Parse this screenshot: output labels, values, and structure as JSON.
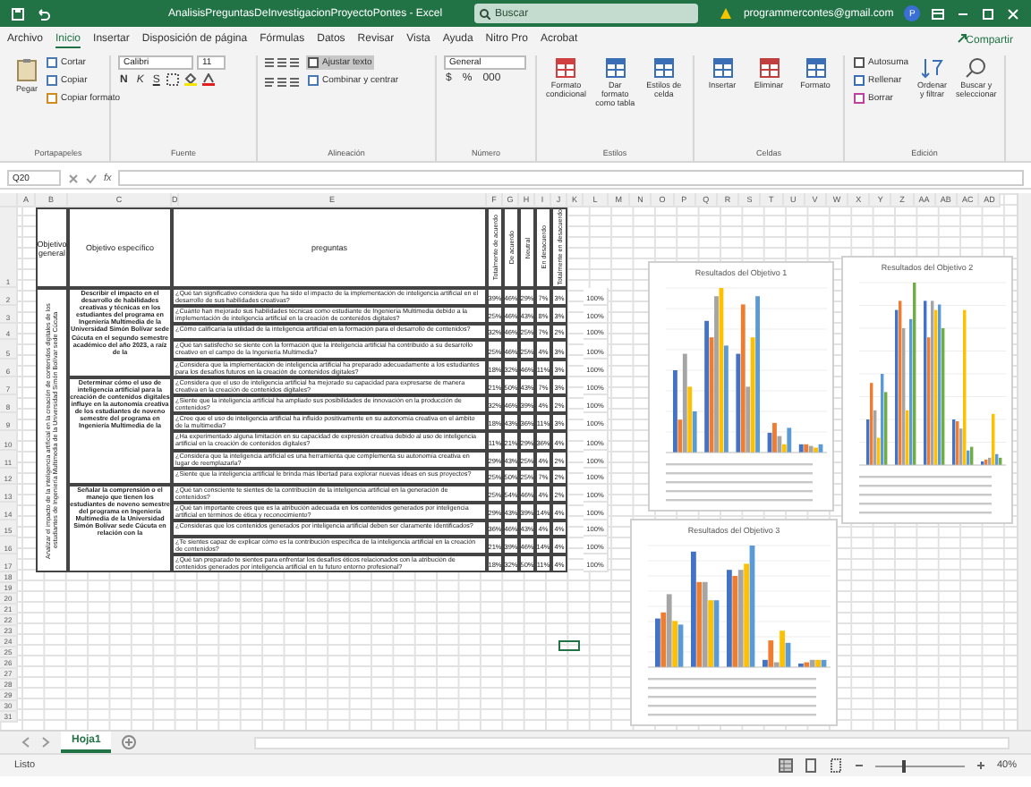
{
  "window": {
    "title": "AnalisisPreguntasDeInvestigacionProyectoPontes - Excel",
    "search_placeholder": "Buscar",
    "account": "programmercontes@gmail.com",
    "avatar": "P"
  },
  "menu_tabs": [
    {
      "label": "Archivo",
      "selected": false
    },
    {
      "label": "Inicio",
      "selected": true
    },
    {
      "label": "Insertar",
      "selected": false
    },
    {
      "label": "Disposición de página",
      "selected": false
    },
    {
      "label": "Fórmulas",
      "selected": false
    },
    {
      "label": "Datos",
      "selected": false
    },
    {
      "label": "Revisar",
      "selected": false
    },
    {
      "label": "Vista",
      "selected": false
    },
    {
      "label": "Ayuda",
      "selected": false
    },
    {
      "label": "Nitro Pro",
      "selected": false
    },
    {
      "label": "Acrobat",
      "selected": false
    }
  ],
  "share": "Compartir",
  "ribbon": {
    "clipboard": {
      "label": "Portapapeles",
      "paste": "Pegar",
      "items": [
        "Cortar",
        "Copiar",
        "Copiar formato"
      ]
    },
    "font": {
      "label": "Fuente",
      "name": "Calibri",
      "size": "11",
      "keys": [
        "N",
        "K",
        "S"
      ]
    },
    "alignment": {
      "label": "Alineación",
      "wrap": "Ajustar texto",
      "merge": "Combinar y centrar"
    },
    "number": {
      "label": "Número",
      "format": "General",
      "keys": [
        "$",
        "%",
        "000"
      ]
    },
    "styles": {
      "label": "Estilos",
      "items": [
        "Formato condicional",
        "Dar formato como tabla",
        "Estilos de celda"
      ]
    },
    "cells": {
      "label": "Celdas",
      "items": [
        "Insertar",
        "Eliminar",
        "Formato"
      ]
    },
    "editing": {
      "label": "Edición",
      "small": [
        "Autosuma",
        "Rellenar",
        "Borrar"
      ],
      "items": [
        "Ordenar y filtrar",
        "Buscar y seleccionar"
      ]
    }
  },
  "formula_bar": {
    "name_box": "Q20",
    "fx": "fx"
  },
  "columns": [
    "A",
    "B",
    "C",
    "D",
    "E",
    "F",
    "G",
    "H",
    "I",
    "J",
    "K",
    "L",
    "M",
    "N",
    "O",
    "P",
    "Q",
    "R",
    "S",
    "T",
    "U",
    "V",
    "W",
    "X",
    "Y",
    "Z",
    "AA",
    "AB",
    "AC",
    "AD"
  ],
  "row_numbers": [
    "1",
    "2",
    "3",
    "4",
    "5",
    "6",
    "7",
    "8",
    "9",
    "10",
    "11",
    "12",
    "13",
    "14",
    "15",
    "16",
    "17",
    "18",
    "19",
    "20",
    "21",
    "22",
    "23",
    "24",
    "25",
    "26",
    "27",
    "28",
    "29",
    "30",
    "31"
  ],
  "table": {
    "headers": {
      "general": "Objetivo general",
      "specific": "Objetivo específico",
      "questions": "preguntas",
      "answers": [
        "Totalmente de acuerdo",
        "De acuerdo",
        "Neutral",
        "En desacuerdo",
        "Totalmente en desacuerdo"
      ]
    },
    "general_objective": "Analizar el impacto de la inteligencia artificial en la creación de contenidos digitales de los estudiantes de Ingeniería Multimedia de la Universidad Simón Bolívar sede Cúcuta",
    "objectives": [
      {
        "text": "Describir el impacto en el desarrollo de habilidades creativas y técnicas en los estudiantes del programa en Ingeniería Multimedia de la Universidad Simón Bolívar sede Cúcuta en el segundo semestre académico del año 2023, a raíz de la",
        "questions": [
          {
            "text": "¿Qué tan significativo considera que ha sido el impacto de la implementación de inteligencia artificial en el desarrollo de sus habilidades creativas?",
            "values": [
              "39%",
              "46%",
              "29%",
              "7%",
              "3%"
            ],
            "total": "100%"
          },
          {
            "text": "¿Cuánto han mejorado sus habilidades técnicas como estudiante de Ingeniería Multimedia debido a la implementación de inteligencia artificial en la creación de contenidos digitales?",
            "values": [
              "25%",
              "46%",
              "43%",
              "8%",
              "3%"
            ],
            "total": "100%"
          },
          {
            "text": "¿Cómo calificaría la utilidad de la inteligencia artificial en la formación para el desarrollo de contenidos?",
            "values": [
              "32%",
              "46%",
              "25%",
              "7%",
              "2%"
            ],
            "total": "100%"
          },
          {
            "text": "¿Qué tan satisfecho se siente con la formación que la inteligencia artificial ha contribuido a su desarrollo creativo en el campo de la Ingeniería Multimedia?",
            "values": [
              "25%",
              "46%",
              "25%",
              "4%",
              "3%"
            ],
            "total": "100%"
          },
          {
            "text": "¿Considera que la implementación de inteligencia artificial ha preparado adecuadamente a los estudiantes para los desafíos futuros en la creación de contenidos digitales?",
            "values": [
              "18%",
              "32%",
              "46%",
              "11%",
              "3%"
            ],
            "total": "100%"
          }
        ]
      },
      {
        "text": "Determinar cómo el uso de inteligencia artificial para la creación de contenidos digitales influye en la autonomía creativa de los estudiantes de noveno semestre del programa en Ingeniería Multimedia de la",
        "questions": [
          {
            "text": "¿Considera que el uso de inteligencia artificial ha mejorado su capacidad para expresarse de manera creativa en la creación de contenidos digitales?",
            "values": [
              "21%",
              "50%",
              "43%",
              "7%",
              "3%"
            ],
            "total": "100%"
          },
          {
            "text": "¿Siente que la inteligencia artificial ha ampliado sus posibilidades de innovación en la producción de contenidos?",
            "values": [
              "32%",
              "46%",
              "39%",
              "4%",
              "2%"
            ],
            "total": "100%"
          },
          {
            "text": "¿Cree que el uso de inteligencia artificial ha influido positivamente en su autonomía creativa en el ámbito de la multimedia?",
            "values": [
              "18%",
              "43%",
              "36%",
              "11%",
              "3%"
            ],
            "total": "100%"
          },
          {
            "text": "¿Ha experimentado alguna limitación en su capacidad de expresión creativa debido al uso de inteligencia artificial en la creación de contenidos digitales?",
            "values": [
              "11%",
              "21%",
              "29%",
              "36%",
              "4%"
            ],
            "total": "100%"
          },
          {
            "text": "¿Considera que la inteligencia artificial es una herramienta que complementa su autonomía creativa en lugar de reemplazarla?",
            "values": [
              "29%",
              "43%",
              "25%",
              "4%",
              "2%"
            ],
            "total": "100%"
          },
          {
            "text": "¿Siente que la inteligencia artificial le brinda más libertad para explorar nuevas ideas en sus proyectos?",
            "values": [
              "25%",
              "50%",
              "25%",
              "7%",
              "2%"
            ],
            "total": "100%"
          }
        ]
      },
      {
        "text": "Señalar la comprensión o el manejo que tienen los estudiantes de noveno semestre del programa en Ingeniería Multimedia de la Universidad Simón Bolívar sede Cúcuta en relación con la",
        "questions": [
          {
            "text": "¿Qué tan consciente te sientes de la contribución de la inteligencia artificial en la generación de contenidos?",
            "values": [
              "25%",
              "54%",
              "46%",
              "4%",
              "2%"
            ],
            "total": "100%"
          },
          {
            "text": "¿Qué tan importante crees que es la atribución adecuada en los contenidos generados por inteligencia artificial en términos de ética y reconocimiento?",
            "values": [
              "29%",
              "43%",
              "39%",
              "14%",
              "4%"
            ],
            "total": "100%"
          },
          {
            "text": "¿Consideras que los contenidos generados por inteligencia artificial deben ser claramente identificados?",
            "values": [
              "36%",
              "46%",
              "43%",
              "4%",
              "4%"
            ],
            "total": "100%"
          },
          {
            "text": "¿Te sientes capaz de explicar cómo es la contribución específica de la inteligencia artificial en la creación de contenidos?",
            "values": [
              "21%",
              "39%",
              "46%",
              "14%",
              "4%"
            ],
            "total": "100%"
          },
          {
            "text": "¿Qué tan preparado te sientes para enfrentar los desafíos éticos relacionados con la atribución de contenidos generados por inteligencia artificial en tu futuro entorno profesional?",
            "values": [
              "18%",
              "32%",
              "50%",
              "11%",
              "4%"
            ],
            "total": "100%"
          }
        ]
      }
    ]
  },
  "charts": [
    {
      "title": "Resultados del Objetivo 1"
    },
    {
      "title": "Resultados del Objetivo 2"
    },
    {
      "title": "Resultados del Objetivo 3"
    }
  ],
  "sheet_tabs": [
    {
      "label": "Hoja1",
      "selected": true
    }
  ],
  "status_bar": {
    "status": "Listo",
    "zoom": "40%",
    "zoom_slider": {
      "level": 0.3
    }
  }
}
